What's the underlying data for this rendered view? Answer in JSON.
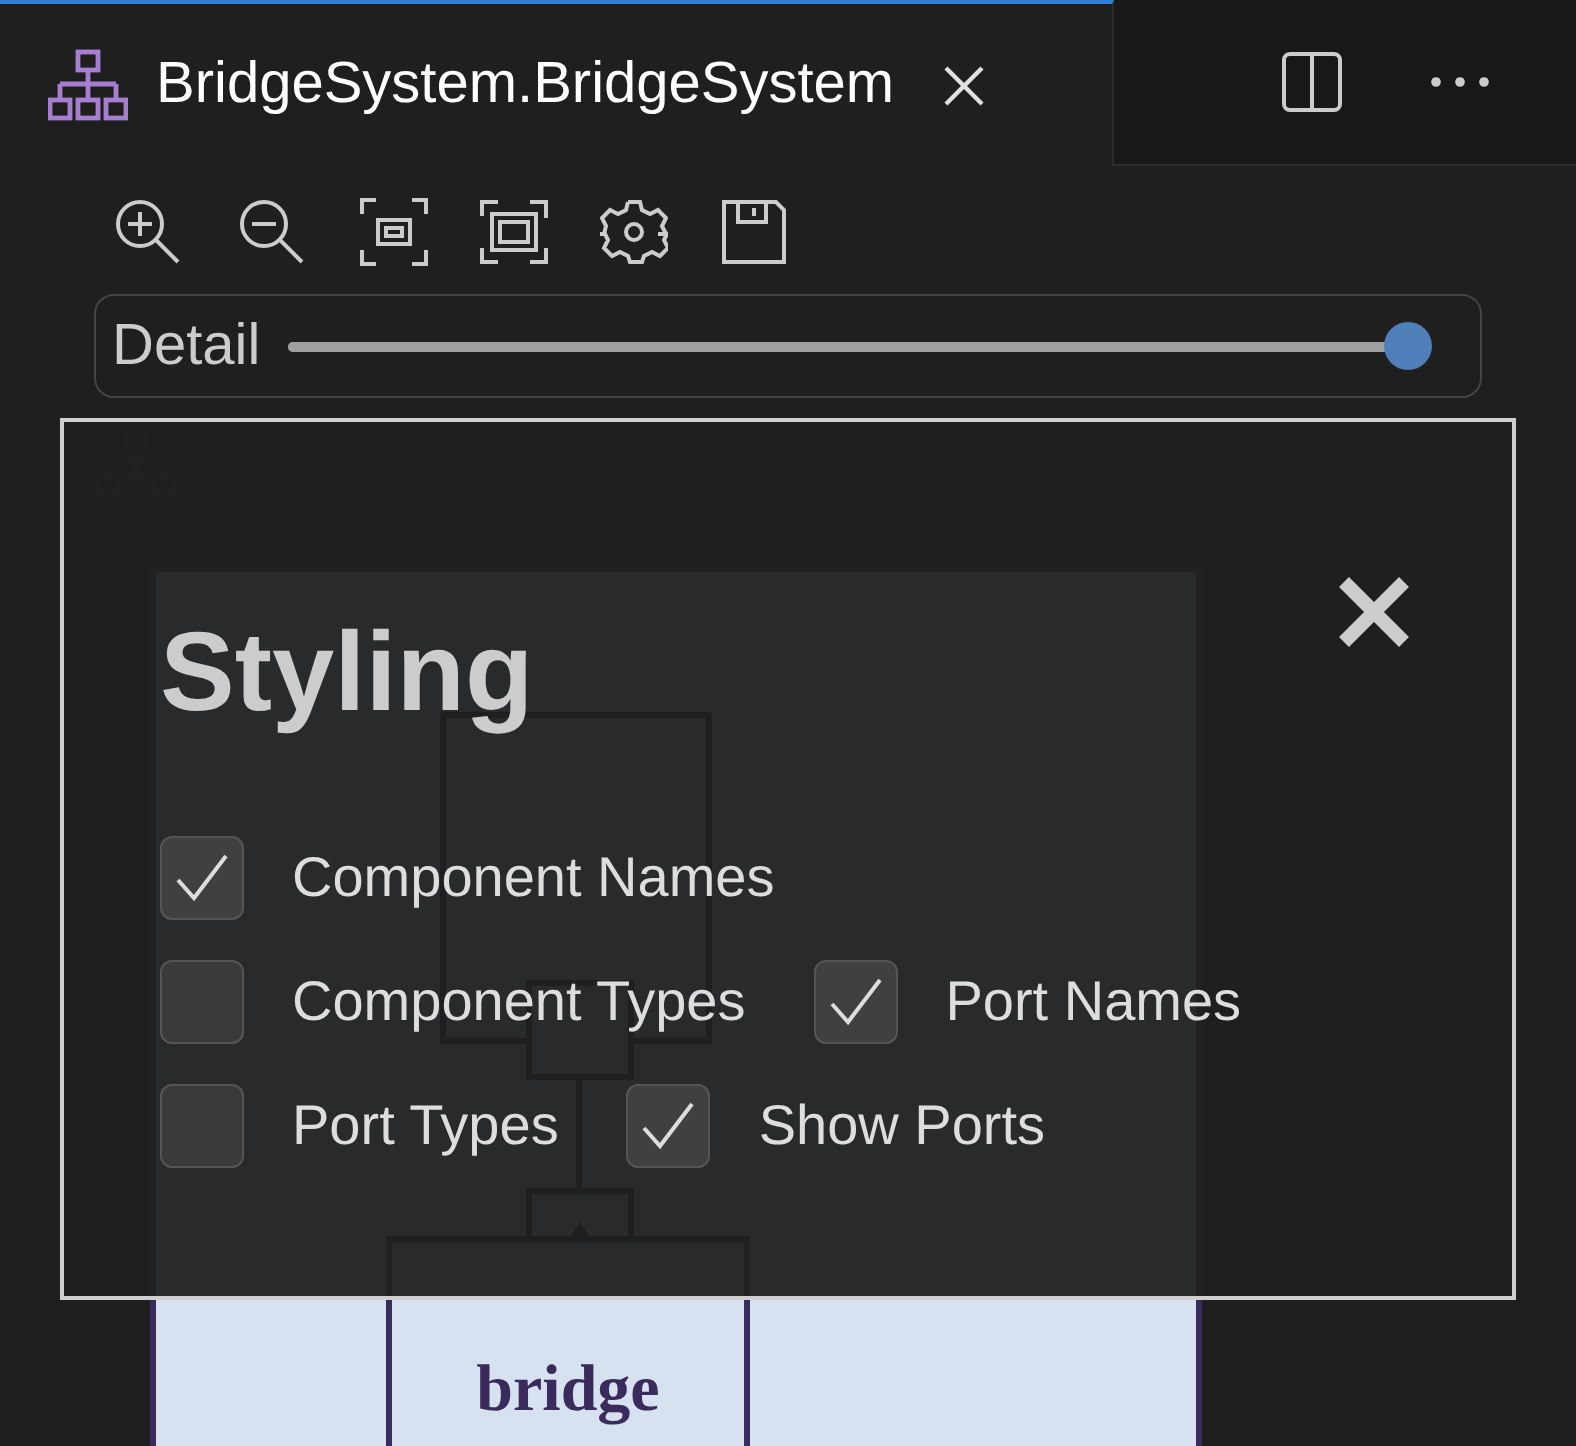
{
  "tabs": [
    {
      "label": "BridgeSystem.BridgeSystem",
      "selected": true
    }
  ],
  "detail": {
    "label": "Detail",
    "level": 1.0
  },
  "diagram": {
    "ports": [
      {
        "kind": "plain"
      },
      {
        "kind": "provided"
      }
    ],
    "component": "bridge"
  },
  "styling": {
    "title": "Styling",
    "option_rows": [
      [
        {
          "label": "Component Names",
          "checked": true
        }
      ],
      [
        {
          "label": "Component Types",
          "checked": false
        },
        {
          "label": "Port Names",
          "checked": true
        }
      ],
      [
        {
          "label": "Port Types",
          "checked": false
        },
        {
          "label": "Show Ports",
          "checked": true
        }
      ]
    ]
  }
}
